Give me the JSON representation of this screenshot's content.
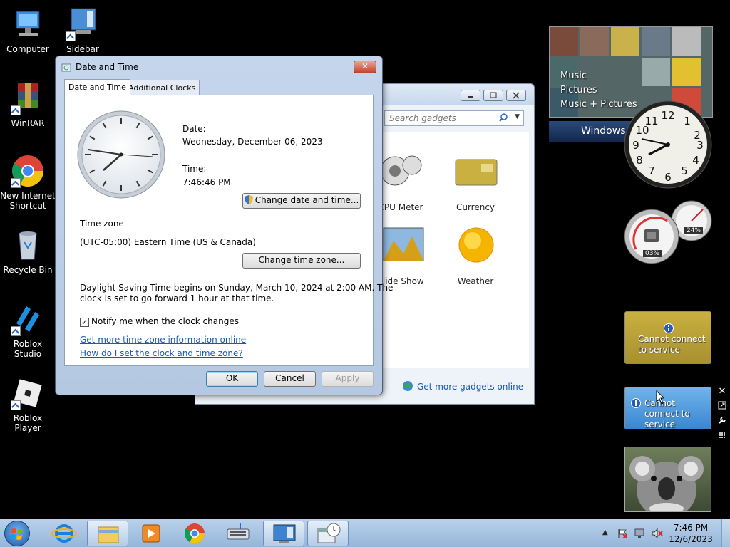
{
  "desktop": {
    "icons": [
      {
        "label": "Computer"
      },
      {
        "label": "Sidebar"
      },
      {
        "label": "WinRAR"
      },
      {
        "label": "New Internet Shortcut"
      },
      {
        "label": "Recycle Bin"
      },
      {
        "label": "Roblox Studio"
      },
      {
        "label": "Roblox Player"
      }
    ]
  },
  "gadget_window": {
    "search_placeholder": "Search gadgets",
    "gadgets": [
      {
        "label": "CPU Meter"
      },
      {
        "label": "Currency"
      },
      {
        "label": "Slide Show"
      },
      {
        "label": "Weather"
      }
    ],
    "footer_link": "Get more gadgets online"
  },
  "dialog": {
    "title": "Date and Time",
    "close_label": "✕",
    "tabs": [
      {
        "label": "Date and Time"
      },
      {
        "label": "Additional Clocks"
      }
    ],
    "date_label": "Date:",
    "date_value": "Wednesday, December 06, 2023",
    "time_label": "Time:",
    "time_value": "7:46:46 PM",
    "change_datetime_button": "Change date and time...",
    "timezone_header": "Time zone",
    "timezone_value": "(UTC-05:00) Eastern Time (US & Canada)",
    "change_timezone_button": "Change time zone...",
    "dst_text_line1": "Daylight Saving Time begins on Sunday, March 10, 2024 at 2:00 AM. The",
    "dst_text_line2": "clock is set to go forward 1 hour at that time.",
    "notify_checkbox_label": "Notify me when the clock changes",
    "notify_checked": true,
    "link_more_info": "Get more time zone information online",
    "link_how_set": "How do I set the clock and time zone?",
    "ok_button": "OK",
    "cancel_button": "Cancel",
    "apply_button": "Apply"
  },
  "sidebar": {
    "media_items": [
      "Music",
      "Pictures",
      "Music + Pictures"
    ],
    "windows_label": "Windows",
    "cpu_readout": "03%",
    "mem_readout": "24%",
    "currency_error": "Cannot connect to service",
    "weather_error": "Cannot connect to service"
  },
  "taskbar": {
    "time": "7:46 PM",
    "date": "12/6/2023"
  },
  "colors": {
    "desktop": "#000000",
    "dialog_frame": "#c5d6ec",
    "link": "#1a59b0",
    "taskbar": "#b9d1ea"
  }
}
